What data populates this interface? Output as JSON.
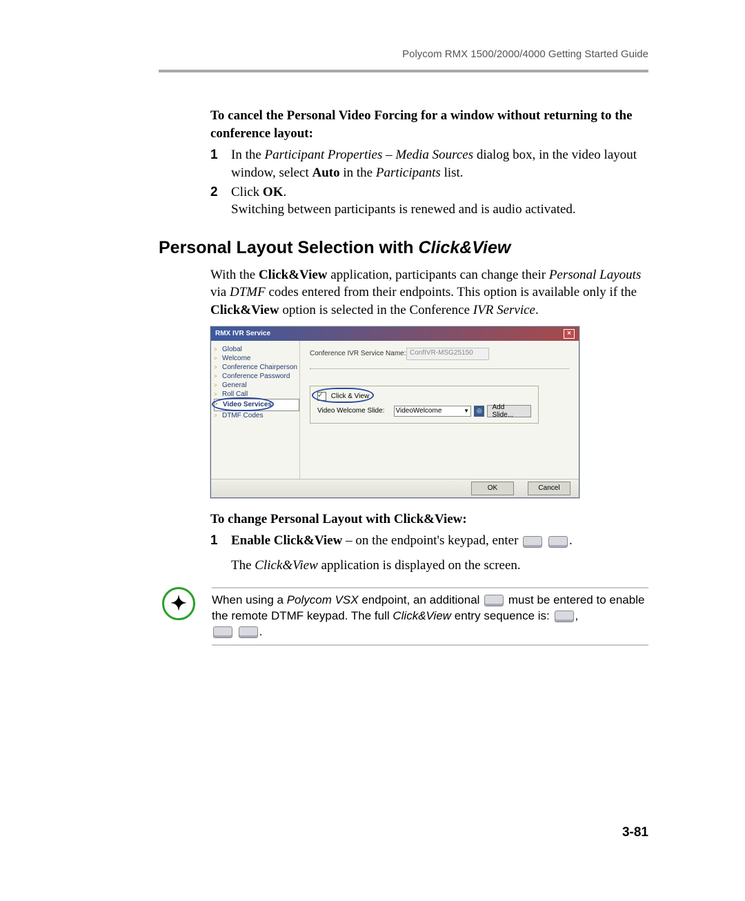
{
  "header": "Polycom RMX 1500/2000/4000 Getting Started Guide",
  "intro_bold": "To cancel the Personal Video Forcing for a window without returning to the conference layout:",
  "step1": {
    "num": "1",
    "pre": "In the ",
    "i1": "Participant Properties – Media Sources",
    "mid": " dialog box, in the video layout window, select ",
    "b1": "Auto",
    "mid2": " in the ",
    "i2": "Participants",
    "post": " list."
  },
  "step2": {
    "num": "2",
    "l1a": "Click ",
    "l1b": "OK",
    "l1c": ".",
    "l2": "Switching between participants is renewed and is audio activated."
  },
  "h2a": "Personal Layout Selection with ",
  "h2b": "Click&View",
  "para1": {
    "a": "With the ",
    "b": "Click&View",
    "c": " application, participants can change their ",
    "d": "Personal Layouts",
    "e": " via ",
    "f": "DTMF",
    "g": " codes entered from their endpoints. This option is available only if the ",
    "h": "Click&View",
    "i": " option is selected in the Conference ",
    "j": "IVR Service",
    "k": "."
  },
  "dlg": {
    "title": "RMX IVR Service",
    "side": [
      "Global",
      "Welcome",
      "Conference Chairperson",
      "Conference Password",
      "General",
      "Roll Call",
      "Video Services",
      "DTMF Codes"
    ],
    "lbl1": "Conference IVR Service Name:",
    "inp1": "ConfIVR-MSG25150",
    "cb": "Click & View",
    "lbl2": "Video Welcome Slide:",
    "sel": "VideoWelcome",
    "addslide": "Add Slide...",
    "ok": "OK",
    "cancel": "Cancel"
  },
  "sub_bold": "To change Personal Layout with Click&View:",
  "step3": {
    "num": "1",
    "b": "Enable Click&View",
    "rest": " – on the endpoint's keypad, enter ",
    "dot": "."
  },
  "para2a": "The ",
  "para2b": "Click&View",
  "para2c": " application is displayed on the screen.",
  "note": {
    "a": "When using a ",
    "b": "Polycom VSX",
    "c": " endpoint, an additional ",
    "d": " must be entered to enable the remote DTMF keypad. The full ",
    "e": "Click&View",
    "f": " entry sequence is: ",
    "g": ","
  },
  "pagenum": "3-81"
}
